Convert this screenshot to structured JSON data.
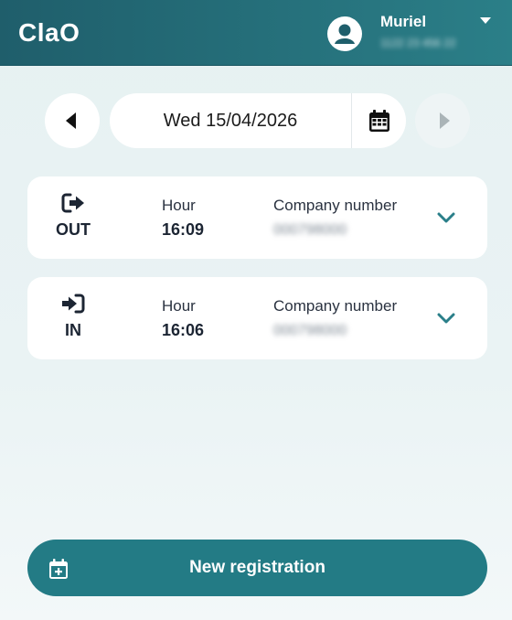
{
  "app": {
    "title": "ClaO"
  },
  "user": {
    "name": "Muriel",
    "sub_obscured": "1122 23 456 22"
  },
  "date_nav": {
    "date": "Wed 15/04/2026"
  },
  "entries": [
    {
      "direction": "OUT",
      "hour_label": "Hour",
      "hour": "16:09",
      "company_label": "Company number",
      "company_number": "000798000"
    },
    {
      "direction": "IN",
      "hour_label": "Hour",
      "hour": "16:06",
      "company_label": "Company number",
      "company_number": "000798000"
    }
  ],
  "actions": {
    "new_registration": "New registration"
  },
  "colors": {
    "header": "#2b7f88",
    "accent": "#237b85",
    "chevron": "#2a7f89"
  }
}
